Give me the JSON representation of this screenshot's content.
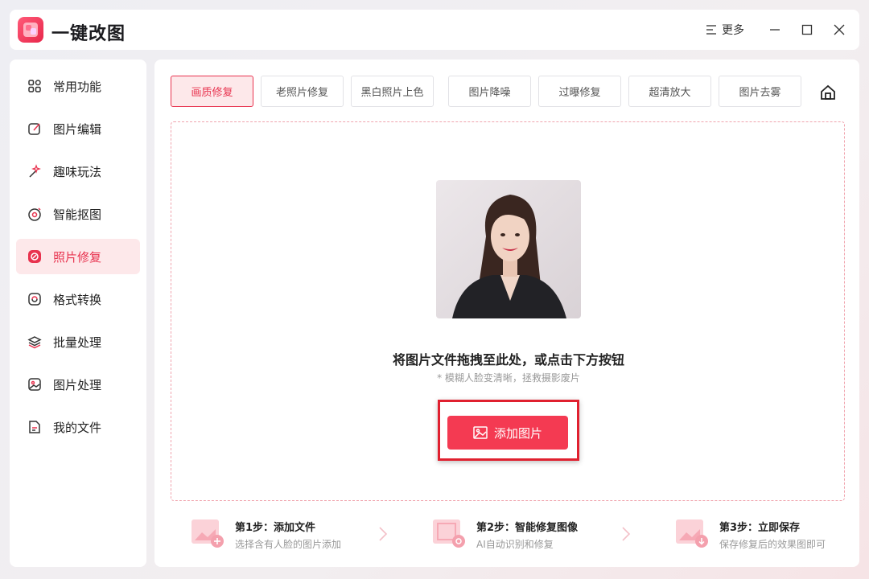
{
  "app": {
    "title": "一键改图"
  },
  "titlebar": {
    "menu_label": "更多"
  },
  "sidebar": {
    "items": [
      {
        "label": "常用功能",
        "icon": "grid-icon"
      },
      {
        "label": "图片编辑",
        "icon": "edit-icon"
      },
      {
        "label": "趣味玩法",
        "icon": "magic-wand-icon"
      },
      {
        "label": "智能抠图",
        "icon": "target-icon"
      },
      {
        "label": "照片修复",
        "icon": "repair-icon",
        "active": true
      },
      {
        "label": "格式转换",
        "icon": "convert-icon"
      },
      {
        "label": "批量处理",
        "icon": "layers-icon"
      },
      {
        "label": "图片处理",
        "icon": "image-icon"
      },
      {
        "label": "我的文件",
        "icon": "file-icon"
      }
    ]
  },
  "tabs": [
    {
      "label": "画质修复",
      "active": true
    },
    {
      "label": "老照片修复"
    },
    {
      "label": "黑白照片上色"
    },
    {
      "label": "图片降噪"
    },
    {
      "label": "过曝修复"
    },
    {
      "label": "超清放大"
    },
    {
      "label": "图片去雾"
    }
  ],
  "dropzone": {
    "title": "将图片文件拖拽至此处，或点击下方按钮",
    "subtitle": "* 模糊人脸变清晰，拯救摄影废片",
    "button_label": "添加图片"
  },
  "steps": [
    {
      "title": "第1步：添加文件",
      "desc": "选择含有人脸的图片添加"
    },
    {
      "title": "第2步：智能修复图像",
      "desc": "AI自动识别和修复"
    },
    {
      "title": "第3步：立即保存",
      "desc": "保存修复后的效果图即可"
    }
  ],
  "colors": {
    "accent": "#f43a52",
    "active_bg": "#fde8ea",
    "highlight": "#e0202f"
  }
}
